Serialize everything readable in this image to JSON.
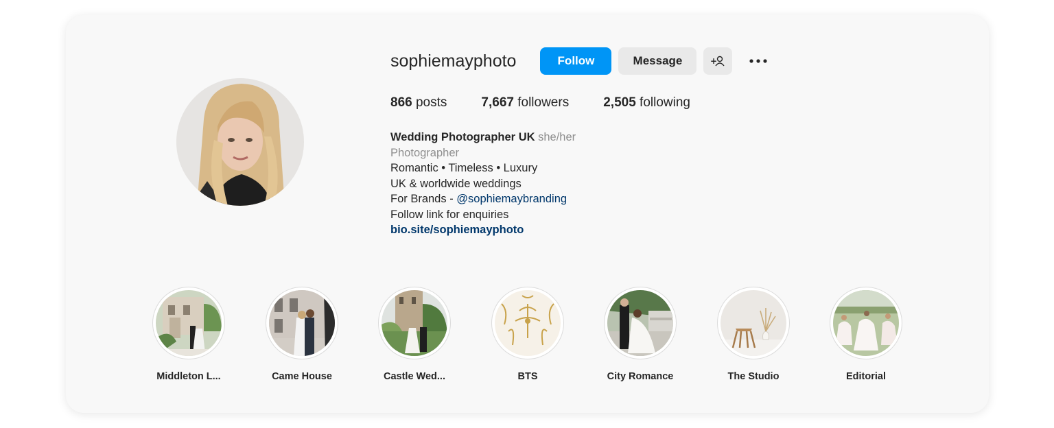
{
  "profile": {
    "username": "sophiemayphoto",
    "follow_label": "Follow",
    "message_label": "Message",
    "suggest_icon": "add-person-icon",
    "more_icon": "more-options-icon",
    "accent_color": "#0095f6"
  },
  "stats": {
    "posts_count": "866",
    "posts_label": "posts",
    "followers_count": "7,667",
    "followers_label": "followers",
    "following_count": "2,505",
    "following_label": "following"
  },
  "bio": {
    "name": "Wedding Photographer UK",
    "pronouns": "she/her",
    "category": "Photographer",
    "line1": "Romantic • Timeless • Luxury",
    "line2": "UK & worldwide weddings",
    "line3_prefix": "For Brands - ",
    "line3_mention": "@sophiemaybranding",
    "line4": "Follow link for enquiries",
    "link": "bio.site/sophiemayphoto"
  },
  "highlights": [
    {
      "label": "Middleton L..."
    },
    {
      "label": "Came House"
    },
    {
      "label": "Castle Wed..."
    },
    {
      "label": "BTS"
    },
    {
      "label": "City Romance"
    },
    {
      "label": "The Studio"
    },
    {
      "label": "Editorial"
    }
  ]
}
